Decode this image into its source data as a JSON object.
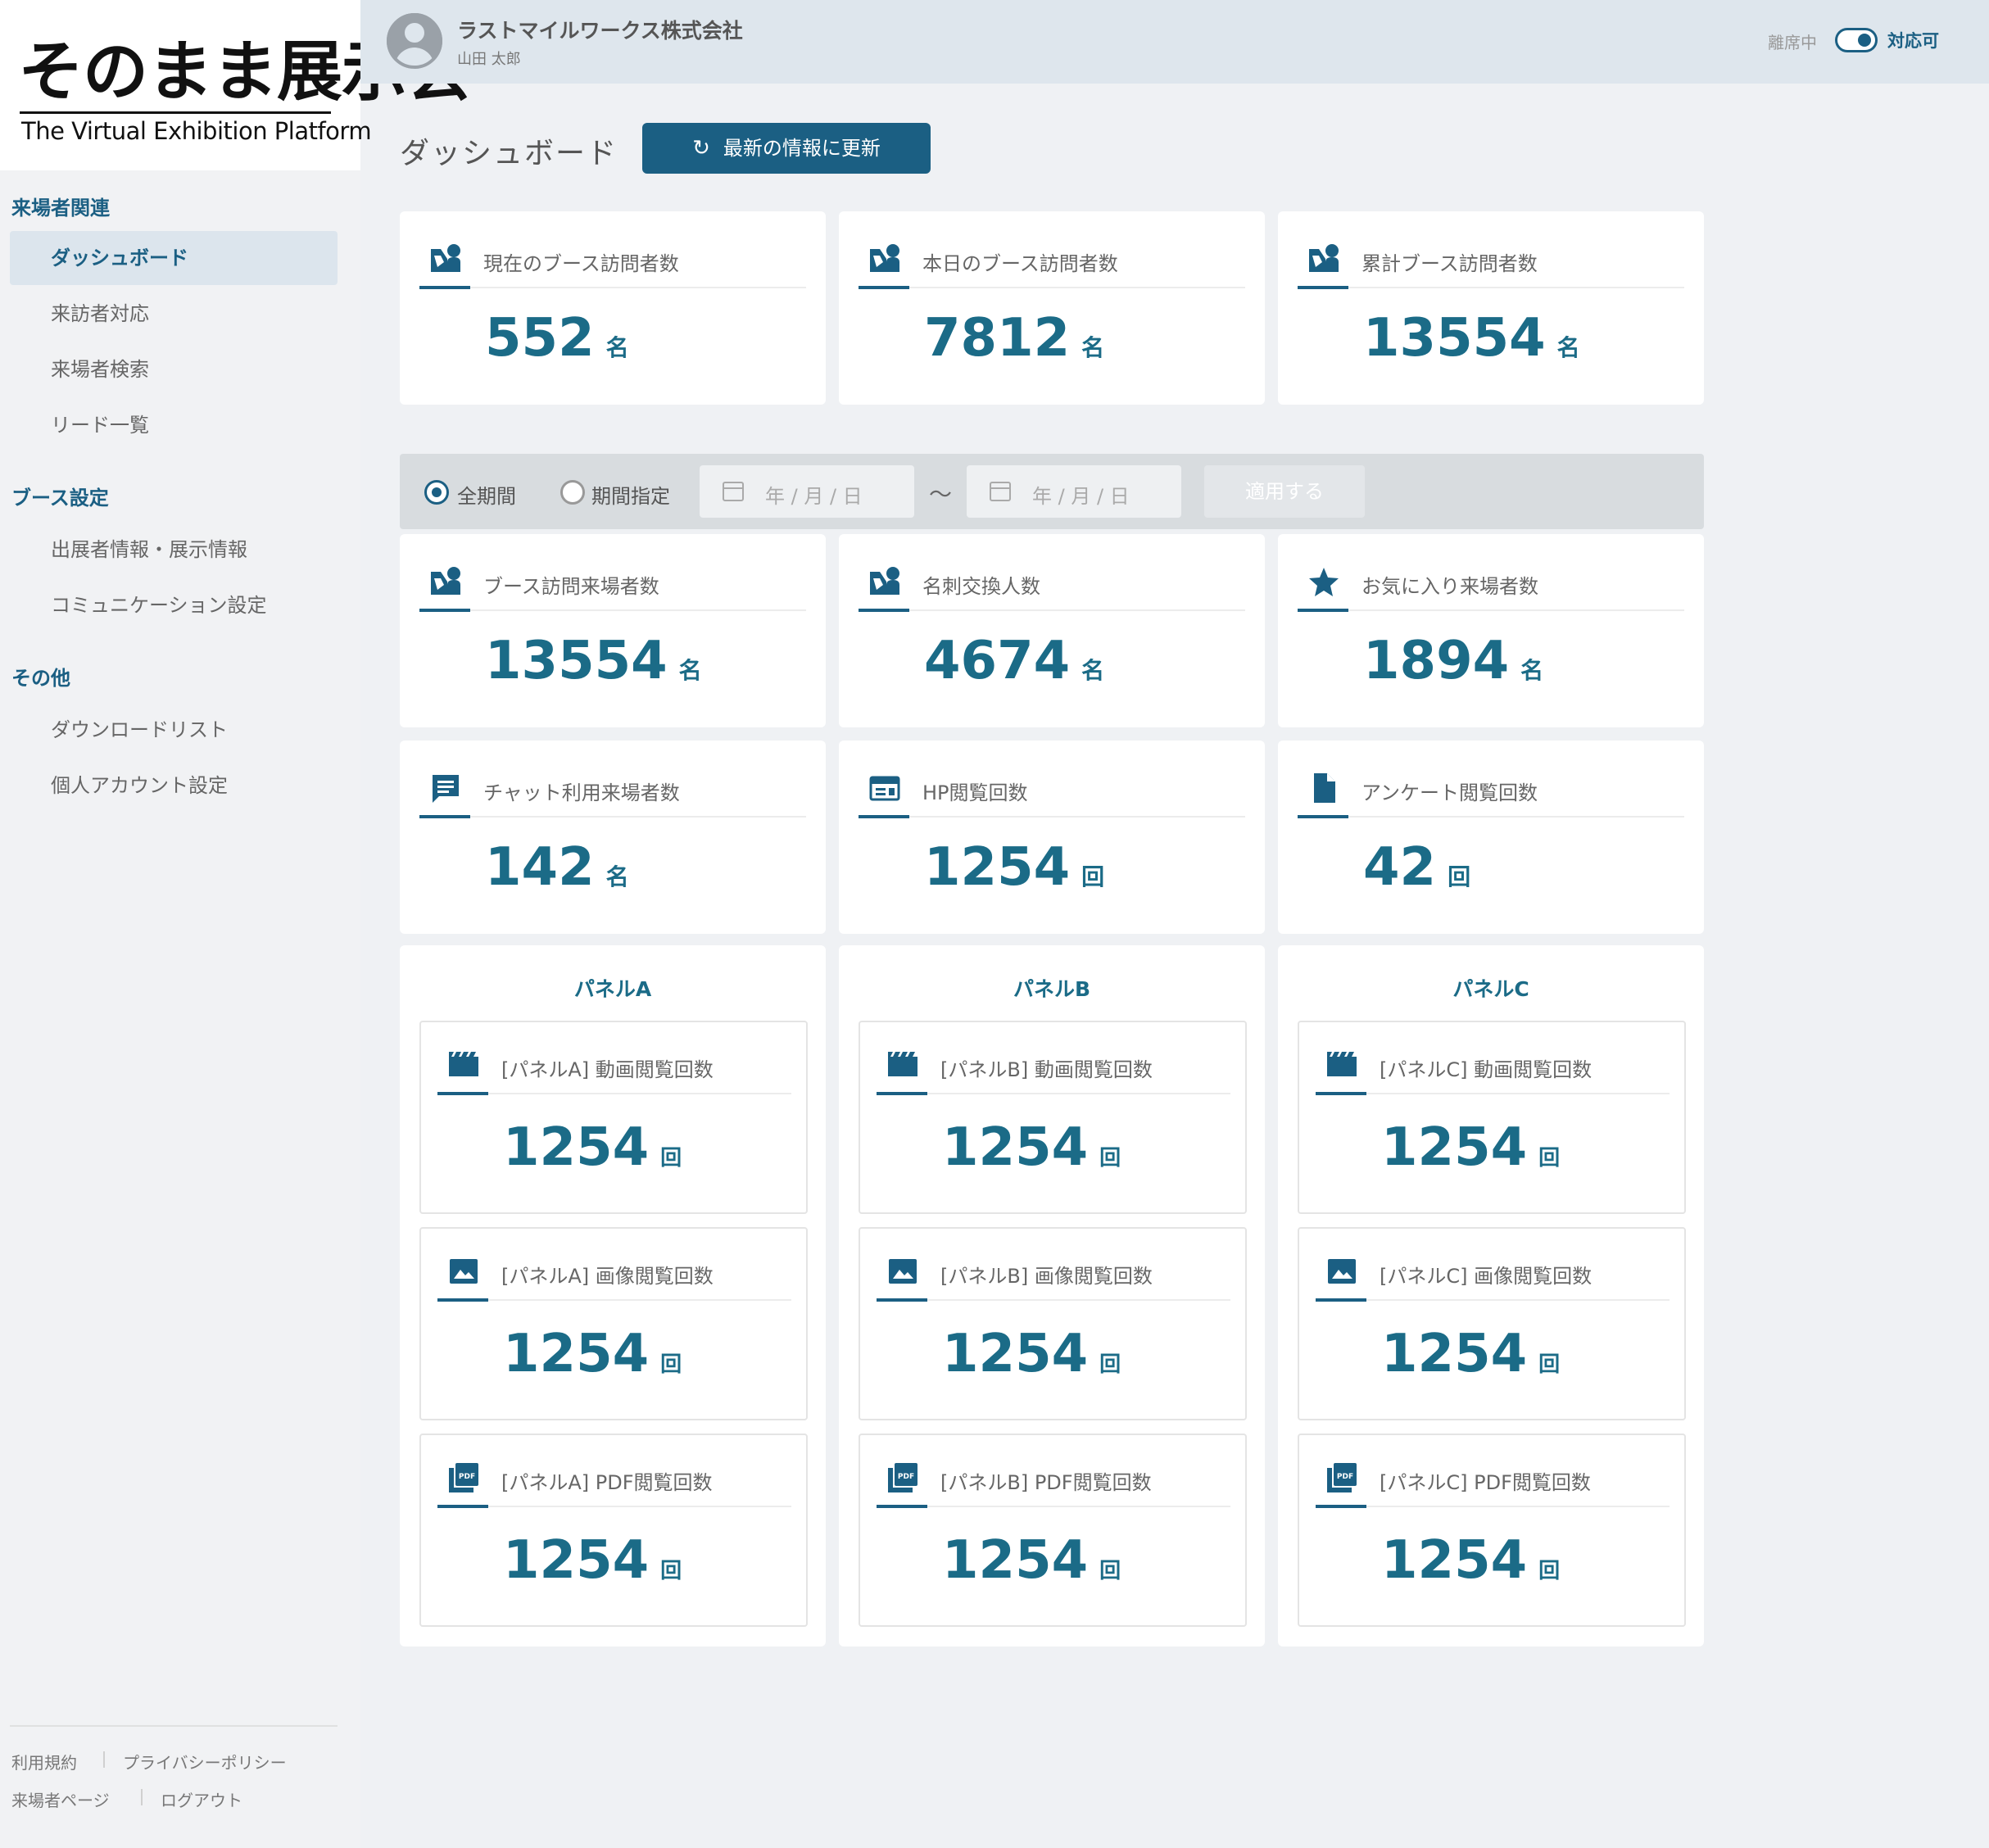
{
  "logo": {
    "title": "そのまま展示会",
    "subtitle": "The Virtual Exhibition Platform"
  },
  "sidebar": {
    "sections": [
      {
        "label": "来場者関連",
        "items": [
          "ダッシュボード",
          "来訪者対応",
          "来場者検索",
          "リード一覧"
        ]
      },
      {
        "label": "ブース設定",
        "items": [
          "出展者情報・展示情報",
          "コミュニケーション設定"
        ]
      },
      {
        "label": "その他",
        "items": [
          "ダウンロードリスト",
          "個人アカウント設定"
        ]
      }
    ],
    "active_item": "ダッシュボード",
    "footer": {
      "terms": "利用規約",
      "privacy": "プライバシーポリシー",
      "visitor_page": "来場者ページ",
      "logout": "ログアウト"
    }
  },
  "header": {
    "company": "ラストマイルワークス株式会社",
    "user": "山田 太郎",
    "status_off": "離席中",
    "status_on": "対応可",
    "toggle_on": true
  },
  "page": {
    "title": "ダッシュボード",
    "refresh_label": "最新の情報に更新"
  },
  "top_stats": [
    {
      "icon": "booth-visitor-icon",
      "label": "現在のブース訪問者数",
      "value": "552",
      "unit": "名"
    },
    {
      "icon": "booth-visitor-icon",
      "label": "本日のブース訪問者数",
      "value": "7812",
      "unit": "名"
    },
    {
      "icon": "booth-visitor-icon",
      "label": "累計ブース訪問者数",
      "value": "13554",
      "unit": "名"
    }
  ],
  "filter": {
    "all_period": "全期間",
    "specify_period": "期間指定",
    "selected": "全期間",
    "date_from_placeholder": "年 / 月 / 日",
    "date_to_placeholder": "年 / 月 / 日",
    "separator": "〜",
    "apply_label": "適用する"
  },
  "period_stats": [
    {
      "icon": "booth-visitor-icon",
      "label": "ブース訪問来場者数",
      "value": "13554",
      "unit": "名"
    },
    {
      "icon": "booth-visitor-icon",
      "label": "名刺交換人数",
      "value": "4674",
      "unit": "名"
    },
    {
      "icon": "star-icon",
      "label": "お気に入り来場者数",
      "value": "1894",
      "unit": "名"
    },
    {
      "icon": "chat-icon",
      "label": "チャット利用来場者数",
      "value": "142",
      "unit": "名"
    },
    {
      "icon": "web-page-icon",
      "label": "HP閲覧回数",
      "value": "1254",
      "unit": "回"
    },
    {
      "icon": "document-icon",
      "label": "アンケート閲覧回数",
      "value": "42",
      "unit": "回"
    }
  ],
  "panels": [
    {
      "title": "パネルA",
      "stats": [
        {
          "icon": "video-icon",
          "label": "[パネルA] 動画閲覧回数",
          "value": "1254",
          "unit": "回"
        },
        {
          "icon": "image-icon",
          "label": "[パネルA] 画像閲覧回数",
          "value": "1254",
          "unit": "回"
        },
        {
          "icon": "pdf-icon",
          "label": "[パネルA] PDF閲覧回数",
          "value": "1254",
          "unit": "回"
        }
      ]
    },
    {
      "title": "パネルB",
      "stats": [
        {
          "icon": "video-icon",
          "label": "[パネルB] 動画閲覧回数",
          "value": "1254",
          "unit": "回"
        },
        {
          "icon": "image-icon",
          "label": "[パネルB] 画像閲覧回数",
          "value": "1254",
          "unit": "回"
        },
        {
          "icon": "pdf-icon",
          "label": "[パネルB] PDF閲覧回数",
          "value": "1254",
          "unit": "回"
        }
      ]
    },
    {
      "title": "パネルC",
      "stats": [
        {
          "icon": "video-icon",
          "label": "[パネルC] 動画閲覧回数",
          "value": "1254",
          "unit": "回"
        },
        {
          "icon": "image-icon",
          "label": "[パネルC] 画像閲覧回数",
          "value": "1254",
          "unit": "回"
        },
        {
          "icon": "pdf-icon",
          "label": "[パネルC] PDF閲覧回数",
          "value": "1254",
          "unit": "回"
        }
      ]
    }
  ],
  "colors": {
    "brand": "#1b5f83",
    "value": "#1b6b87",
    "header_bg": "#dee6ed",
    "active_nav_bg": "#dce5ed"
  }
}
